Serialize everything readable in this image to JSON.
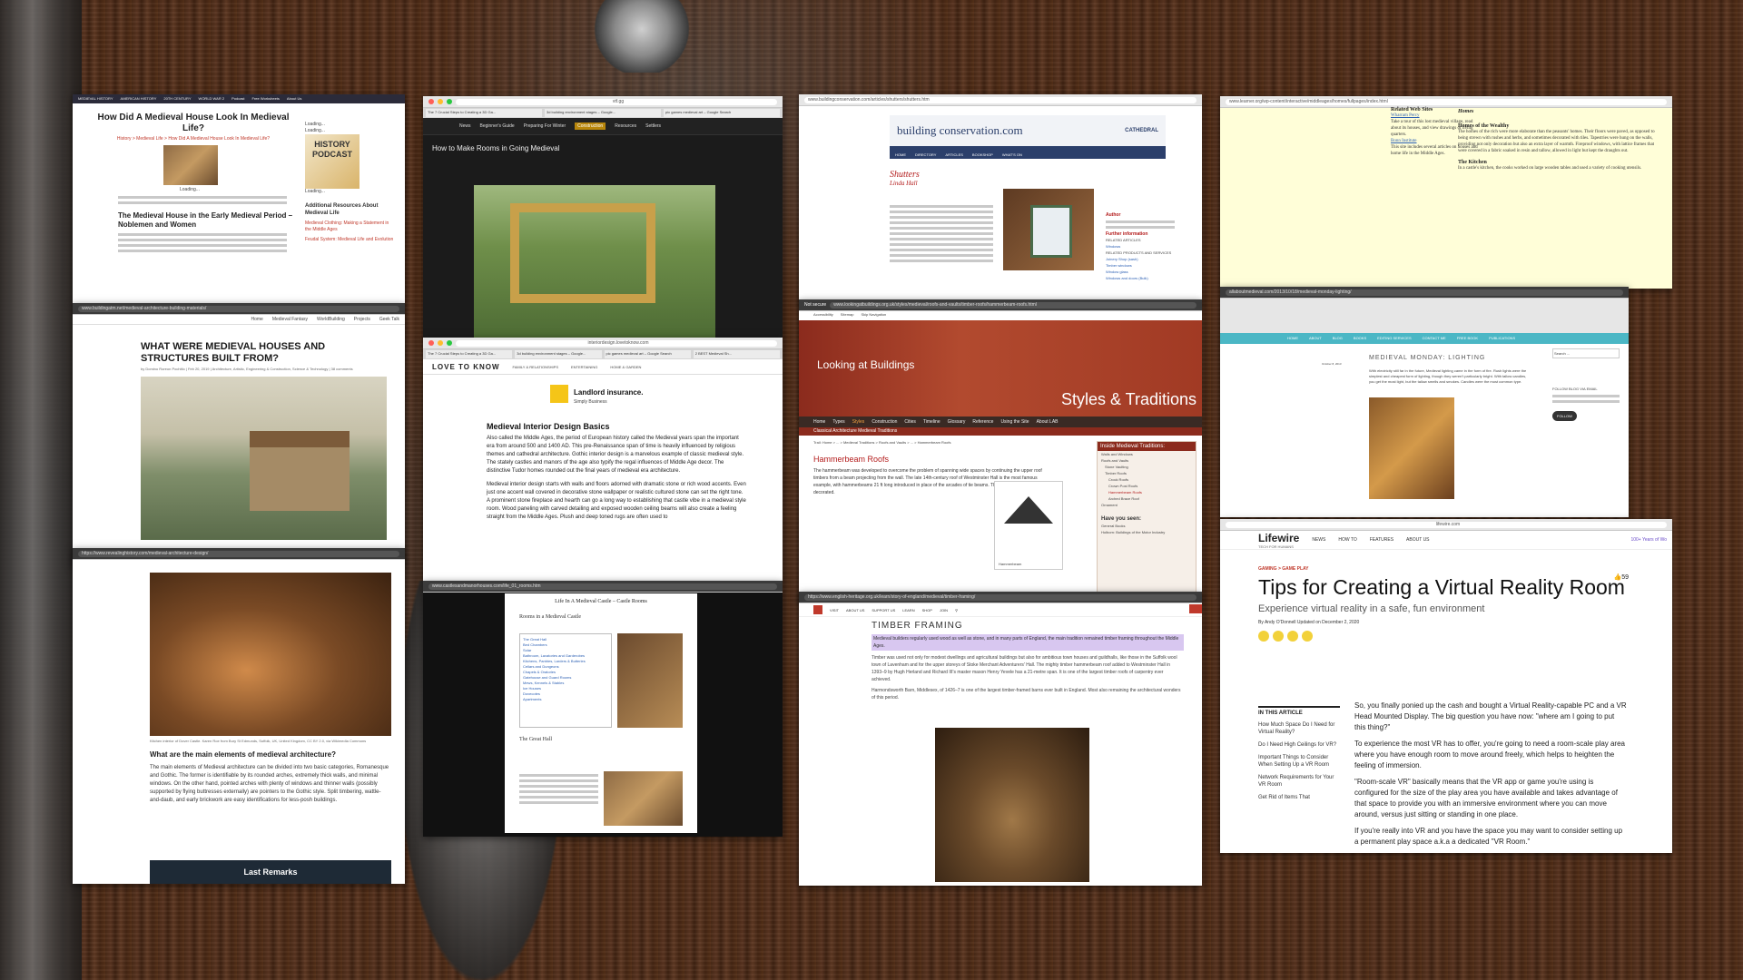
{
  "card1": {
    "nav": [
      "MEDIEVAL HISTORY",
      "AMERICAN HISTORY",
      "20TH CENTURY",
      "WORLD WAR 2",
      "Podcast",
      "Free Worksheets",
      "About Us"
    ],
    "title": "How Did A Medieval House Look In Medieval Life?",
    "crumb": "History > Medieval Life > How Did A Medieval House Look In Medieval Life?",
    "loading": "Loading...",
    "heading2": "The Medieval House in the Early Medieval Period – Noblemen and Women",
    "podcast": "HISTORY PODCAST",
    "resources": "Additional Resources About Medieval Life",
    "link1": "Medieval Clothing: Making a Statement in the Middle Ages",
    "link2": "Feudal System: Medieval Life and Evolution"
  },
  "card2": {
    "url": "www.buildingatm.net/medieval-architecture-building-materials/",
    "nav": [
      "Home",
      "Medieval Fantasy",
      "WorldBuilding",
      "Projects",
      "Geek Talk"
    ],
    "title": "WHAT WERE MEDIEVAL HOUSES AND STRUCTURES BUILT FROM?",
    "meta": "by Domino Roreon Pochitlo | Feb 20, 2019 | Architecture, Artistic, Engineering & Construction, Science & Technology | 38 comments"
  },
  "card3": {
    "url": "https://www.revealinghistory.com/medieval-architecture-design/",
    "caption": "Kitchen interior of Dover Castle. Karen Roe from Bury St Edmunds, Suffolk, UK, United Kingdom, CC BY 2.0, via Wikimedia Commons",
    "question": "What are the main elements of medieval architecture?",
    "para": "The main elements of Medieval architecture can be divided into two basic categories, Romanesque and Gothic. The former is identifiable by its rounded arches, extremely thick walls, and minimal windows. On the other hand, pointed arches with plenty of windows and thinner walls (possibly supported by flying buttresses externally) are pointers to the Gothic style. Split timbering, wattle-and-daub, and early brickwork are easy identifications for less-posh buildings.",
    "last": "Last Remarks"
  },
  "card4": {
    "url": "vtf.gg",
    "tabs": [
      "The 7 Crucial Steps to Creating a 3D Ga...",
      "3d building environment stages – Google...",
      "pic games medieval art – Google Search"
    ],
    "nav": [
      "News",
      "Beginner's Guide",
      "Preparing For Winter",
      "Construction",
      "Resources",
      "Settlers"
    ],
    "title": "How to Make Rooms in Going Medieval"
  },
  "card5": {
    "url": "interiordesign.lovetoknow.com",
    "tabs": [
      "The 7 Crucial Steps to Creating a 3D Ga...",
      "3d building environment stages – Google...",
      "pic games medieval art – Google Search",
      "2 BEST Medieval Sh..."
    ],
    "brand": "LOVE TO KNOW",
    "nav": [
      "FAMILY & RELATIONSHIPS",
      "ENTERTAINING",
      "HOME & GARDEN"
    ],
    "ad": "Landlord insurance.",
    "ad_sub": "Simply Business",
    "title": "Medieval Interior Design Basics",
    "p1": "Also called the Middle Ages, the period of European history called the Medieval years span the important era from around 500 and 1400 AD. This pre-Renaissance span of time is heavily influenced by religious themes and cathedral architecture. Gothic interior design is a marvelous example of classic medieval style. The stately castles and manors of the age also typify the regal influences of Middle Age decor. The distinctive Tudor homes rounded out the final years of medieval era architecture.",
    "p2": "Medieval interior design starts with walls and floors adorned with dramatic stone or rich wood accents. Even just one accent wall covered in decorative stone wallpaper or realistic cultured stone can set the right tone. A prominent stone fireplace and hearth can go a long way to establishing that castle vibe in a medieval style room. Wood paneling with carved detailing and exposed wooden ceiling beams will also create a feeling straight from the Middle Ages. Plush and deep toned rugs are often used to"
  },
  "card6": {
    "url": "www.castlesandmanorhouses.com/life_01_rooms.htm",
    "title": "Life In A Medieval Castle – Castle Rooms",
    "section": "Rooms in a Medieval Castle",
    "toc": [
      "The Great Hall",
      "Bed Chambers",
      "Solar",
      "Bathroom, Lavatories and Garderobes",
      "Kitchens, Pantries, Larders & Butteries",
      "Cellars and Dungeons",
      "Chapels & Oratories",
      "Gatehouse and Guard Rooms",
      "Mews, Kennels & Stables",
      "Ice Houses",
      "Dovecotes",
      "Apartments"
    ],
    "great_hall": "The Great Hall"
  },
  "card7": {
    "url": "www.buildingconservation.com/articles/shutters/shutters.htm",
    "logo": "building conservation.com",
    "logo_right": "CATHEDRAL",
    "nav": [
      "HOME",
      "DIRECTORY",
      "ARTICLES",
      "BOOKSHOP",
      "WHAT'S ON"
    ],
    "title": "Shutters",
    "author": "Linda Hall",
    "side_author": "Author",
    "side_further": "Further information",
    "side_links": [
      "RELATED ARTICLES",
      "Windows",
      "RELATED PRODUCTS AND SERVICES",
      "Joinery Shop (sash)",
      "Timber windows",
      "Window glass",
      "Windows and doors (Bulk)"
    ]
  },
  "card8": {
    "secure": "Not secure",
    "url": "www.lookingatbuildings.org.uk/styles/medieval/roofs-and-vaults/timber-roofs/hammerbeam-roofs.html",
    "top": [
      "Accessibility",
      "Sitemap",
      "Skip Navigation"
    ],
    "brand": "Looking at Buildings",
    "banner": "Styles & Traditions",
    "nav": [
      "Home",
      "Types",
      "Styles",
      "Construction",
      "Cities",
      "Timeline",
      "Glossary",
      "Reference",
      "Using the Site",
      "About LAB"
    ],
    "sub": "Classical Architecture  Medieval Traditions",
    "trail": "Trail: Home > ... > Medieval Traditions > Roofs and Vaults > ... > Hammerbeam Roofs",
    "title": "Hammerbeam Roofs",
    "para": "The hammerbeam was developed to overcome the problem of spanning wide spaces by continuing the upper roof timbers from a beam projecting from the wall. The late 14th-century roof of Westminster Hall is the most famous example, with hammerbeams 21 ft long introduced in place of the arcades of tie beams. The hammerbeams are often decorated.",
    "side_title": "Inside Medieval Traditions:",
    "side_items": [
      "Walls and Windows",
      "Roofs and Vaults",
      "Stone Vaulting",
      "Timber Roofs",
      "Crock Roofs",
      "Crown Post Roofs",
      "Hammerbeam Roofs",
      "Arched Brace Roof",
      "Ornament"
    ],
    "seen": "Have you seen:",
    "seen_items": [
      "General Books",
      "Holborn: Buildings of the Motor Industry"
    ],
    "caption": "Hammerbeam"
  },
  "card9": {
    "url": "https://www.english-heritage.org.uk/learn/story-of-england/medieval/timber-framing/",
    "nav": [
      "VISIT",
      "ABOUT US",
      "SUPPORT US",
      "LEARN",
      "SHOP",
      "JOIN"
    ],
    "menu": "MEN",
    "title": "TIMBER FRAMING",
    "highlight": "Medieval builders regularly used wood as well as stone, and in many parts of England, the main tradition remained timber framing throughout the Middle Ages.",
    "p1": "Timber was used not only for modest dwellings and agricultural buildings but also for ambitious town houses and guildhalls, like those in the Suffolk wool town of Lavenham and for the upper storeys of Stoke Merchant Adventurers' Hall. The mighty timber hammerbeam roof added to Westminster Hall in 1393–9 by Hugh Herland and Richard III's master mason Henry Yevele has a 21-metre span. It is one of the largest timber roofs of carpentry ever achieved.",
    "p2": "Harmondsworth Barn, Middlesex, of 1426–7 is one of the largest timber-framed barns ever built in England. Most also remaining the architectural wonders of this period."
  },
  "card10": {
    "url": "www.learner.org/wp-content/interactive/middleages/homes/fullpages/index.html",
    "left_title": "Related Web Sites",
    "left_items": [
      "Wharram Percy",
      "Take a tour of this lost medieval village, read about its houses, and view drawings of living quarters.",
      "Bonn Institute",
      "This site includes several articles on houses and home life in the Middle Ages."
    ],
    "right_title": "Homes",
    "right_heading": "Homes of the Wealthy",
    "right_p1": "The homes of the rich were more elaborate than the peasants' homes. Their floors were paved, as opposed to being strewn with rushes and herbs, and sometimes decorated with tiles. Tapestries were hung on the walls, providing not only decoration but also an extra layer of warmth. Fireproof windows, with lattice frames that were covered in a fabric soaked in resin and tallow, allowed in light but kept the draughts out.",
    "right_heading2": "The Kitchen",
    "right_p2": "In a castle's kitchen, the cooks worked on large wooden tables and used a variety of cooking utensils."
  },
  "card11": {
    "url": "allaboutmedieval.com/2013/10/18/medieval-monday-lighting/",
    "nav": [
      "HOME",
      "ABOUT",
      "BLOG",
      "BOOKS",
      "EDITING SERVICES",
      "CONTACT ME",
      "FREE BOOK",
      "PUBLICATIONS"
    ],
    "title": "MEDIEVAL MONDAY: LIGHTING",
    "date": "October 8, 2013",
    "para": "With electricity still far in the future, Medieval lighting came in the form of fire. Rush lights were the simplest and cheapest form of lighting, though they weren't particularly bright. With tallow candles, you get the most light, but the tallow smells and smokes. Candles were the most common type.",
    "follow_title": "FOLLOW BLOG VIA EMAIL",
    "follow": "FOLLOW",
    "search": "Search ..."
  },
  "card12": {
    "url": "lifewire.com",
    "logo": "Lifewire",
    "tagline": "TECH FOR HUMANS",
    "nav": [
      "NEWS",
      "HOW TO",
      "FEATURES",
      "ABOUT US"
    ],
    "right": "100+ Years of Wo",
    "category": "GAMING > GAME PLAY",
    "likes": "59",
    "title": "Tips for Creating a Virtual Reality Room",
    "dek": "Experience virtual reality in a safe, fun environment",
    "byline": "By Andy O'Donnell  Updated on December 2, 2020",
    "toc_title": "IN THIS ARTICLE",
    "toc": [
      "How Much Space Do I Need for Virtual Reality?",
      "Do I Need High Ceilings for VR?",
      "Important Things to Consider When Setting Up a VR Room",
      "Network Requirements for Your VR Room",
      "Get Rid of Items That"
    ],
    "p1": "So, you finally ponied up the cash and bought a Virtual Reality-capable PC and a VR Head Mounted Display. The big question you have now: \"where am I going to put this thing?\"",
    "p2": "To experience the most VR has to offer, you're going to need a room-scale play area where you have enough room to move around freely, which helps to heighten the feeling of immersion.",
    "p3": "\"Room-scale VR\" basically means that the VR app or game you're using is configured for the size of the play area you have available and takes advantage of that space to provide you with an immersive environment where you can move around, versus just sitting or standing in one place.",
    "p4": "If you're really into VR and you have the space you may want to consider setting up a permanent play space a.k.a a dedicated \"VR Room.\""
  }
}
